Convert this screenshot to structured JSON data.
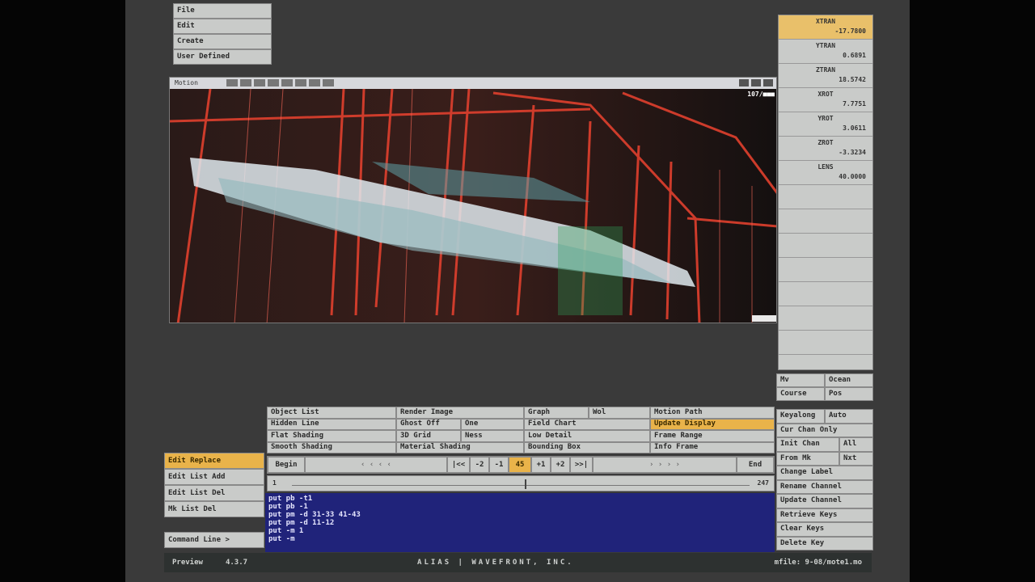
{
  "menu": {
    "items": [
      "File",
      "Edit",
      "Create",
      "User Defined"
    ]
  },
  "viewport": {
    "title": "Motion",
    "readout": "107/■■■"
  },
  "right_panel": {
    "fields": [
      {
        "label": "XTRAN",
        "value": "-17.7800",
        "active": true
      },
      {
        "label": "YTRAN",
        "value": "0.6891"
      },
      {
        "label": "ZTRAN",
        "value": "18.5742"
      },
      {
        "label": "XROT",
        "value": "7.7751"
      },
      {
        "label": "YROT",
        "value": "3.0611"
      },
      {
        "label": "ZROT",
        "value": "-3.3234"
      },
      {
        "label": "LENS",
        "value": "40.0000"
      }
    ],
    "mode_rows": [
      [
        "Mv",
        "Ocean"
      ],
      [
        "Course",
        "Pos"
      ]
    ],
    "key_buttons": [
      [
        "Keyalong",
        "Auto"
      ],
      [
        "Cur Chan Only"
      ],
      [
        "Init Chan",
        "All"
      ],
      [
        "From Mk",
        "Nxt"
      ],
      [
        "Change Label"
      ],
      [
        "Rename Channel"
      ],
      [
        "Update Channel"
      ],
      [
        "Retrieve Keys"
      ],
      [
        "Clear Keys"
      ],
      [
        "Delete Key"
      ]
    ]
  },
  "display_grid": {
    "col1": [
      "Object List",
      "Hidden Line",
      "Flat Shading",
      "Smooth Shading"
    ],
    "col2": [
      [
        "Render Image"
      ],
      [
        "Ghost Off",
        "One"
      ],
      [
        "3D Grid",
        "Ness"
      ],
      [
        "Material Shading"
      ]
    ],
    "col3": [
      [
        "Graph",
        "Wol"
      ],
      [
        "Field Chart"
      ],
      [
        "Low Detail"
      ],
      [
        "Bounding Box"
      ]
    ],
    "col4": [
      "Motion Path",
      "Update Display",
      "Frame Range",
      "Info Frame"
    ],
    "highlighted": "Update Display"
  },
  "edit_buttons": [
    "Edit Replace",
    "Edit List Add",
    "Edit List Del",
    "Mk List Del"
  ],
  "edit_highlighted": "Edit Replace",
  "transport": {
    "begin": "Begin",
    "end": "End",
    "buttons": [
      "|<<",
      "-2",
      "-1",
      "45",
      "+1",
      "+2",
      ">>|"
    ],
    "current": "45",
    "slider_start": "1",
    "slider_end": "247"
  },
  "command_line": {
    "label": "Command Line >",
    "lines": [
      "put pb -t1",
      "put pb -1",
      "put pm -d 31-33 41-43",
      "put pm -d 11-12",
      "put -m 1",
      "put -m"
    ]
  },
  "footer": {
    "app": "Preview",
    "version": "4.3.7",
    "company": "ALIAS | WAVEFRONT, INC.",
    "user": "mfile: 9-08/mote1.mo"
  }
}
